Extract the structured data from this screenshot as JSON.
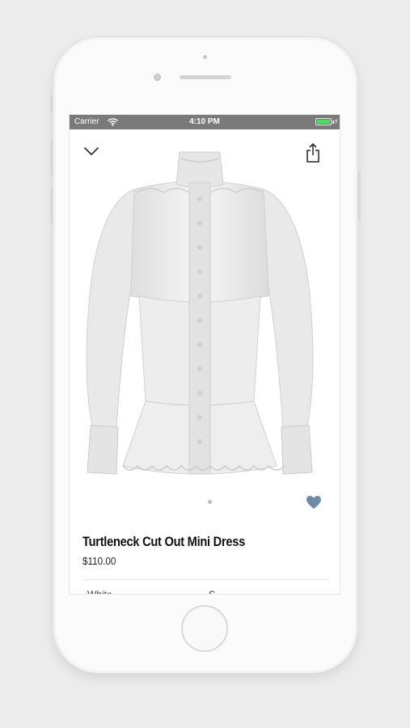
{
  "status_bar": {
    "carrier": "Carrier",
    "time": "4:10 PM"
  },
  "product": {
    "name": "Turtleneck Cut Out Mini Dress",
    "price": "$110.00",
    "color": "White",
    "size": "S"
  },
  "icons": {
    "back": "chevron-down-icon",
    "share": "share-icon",
    "favorite": "heart-icon",
    "wifi": "wifi-icon",
    "battery": "battery-icon"
  },
  "colors": {
    "status_bar": "#7a7a7a",
    "battery": "#4cd964",
    "heart": "#6f8aa6"
  }
}
